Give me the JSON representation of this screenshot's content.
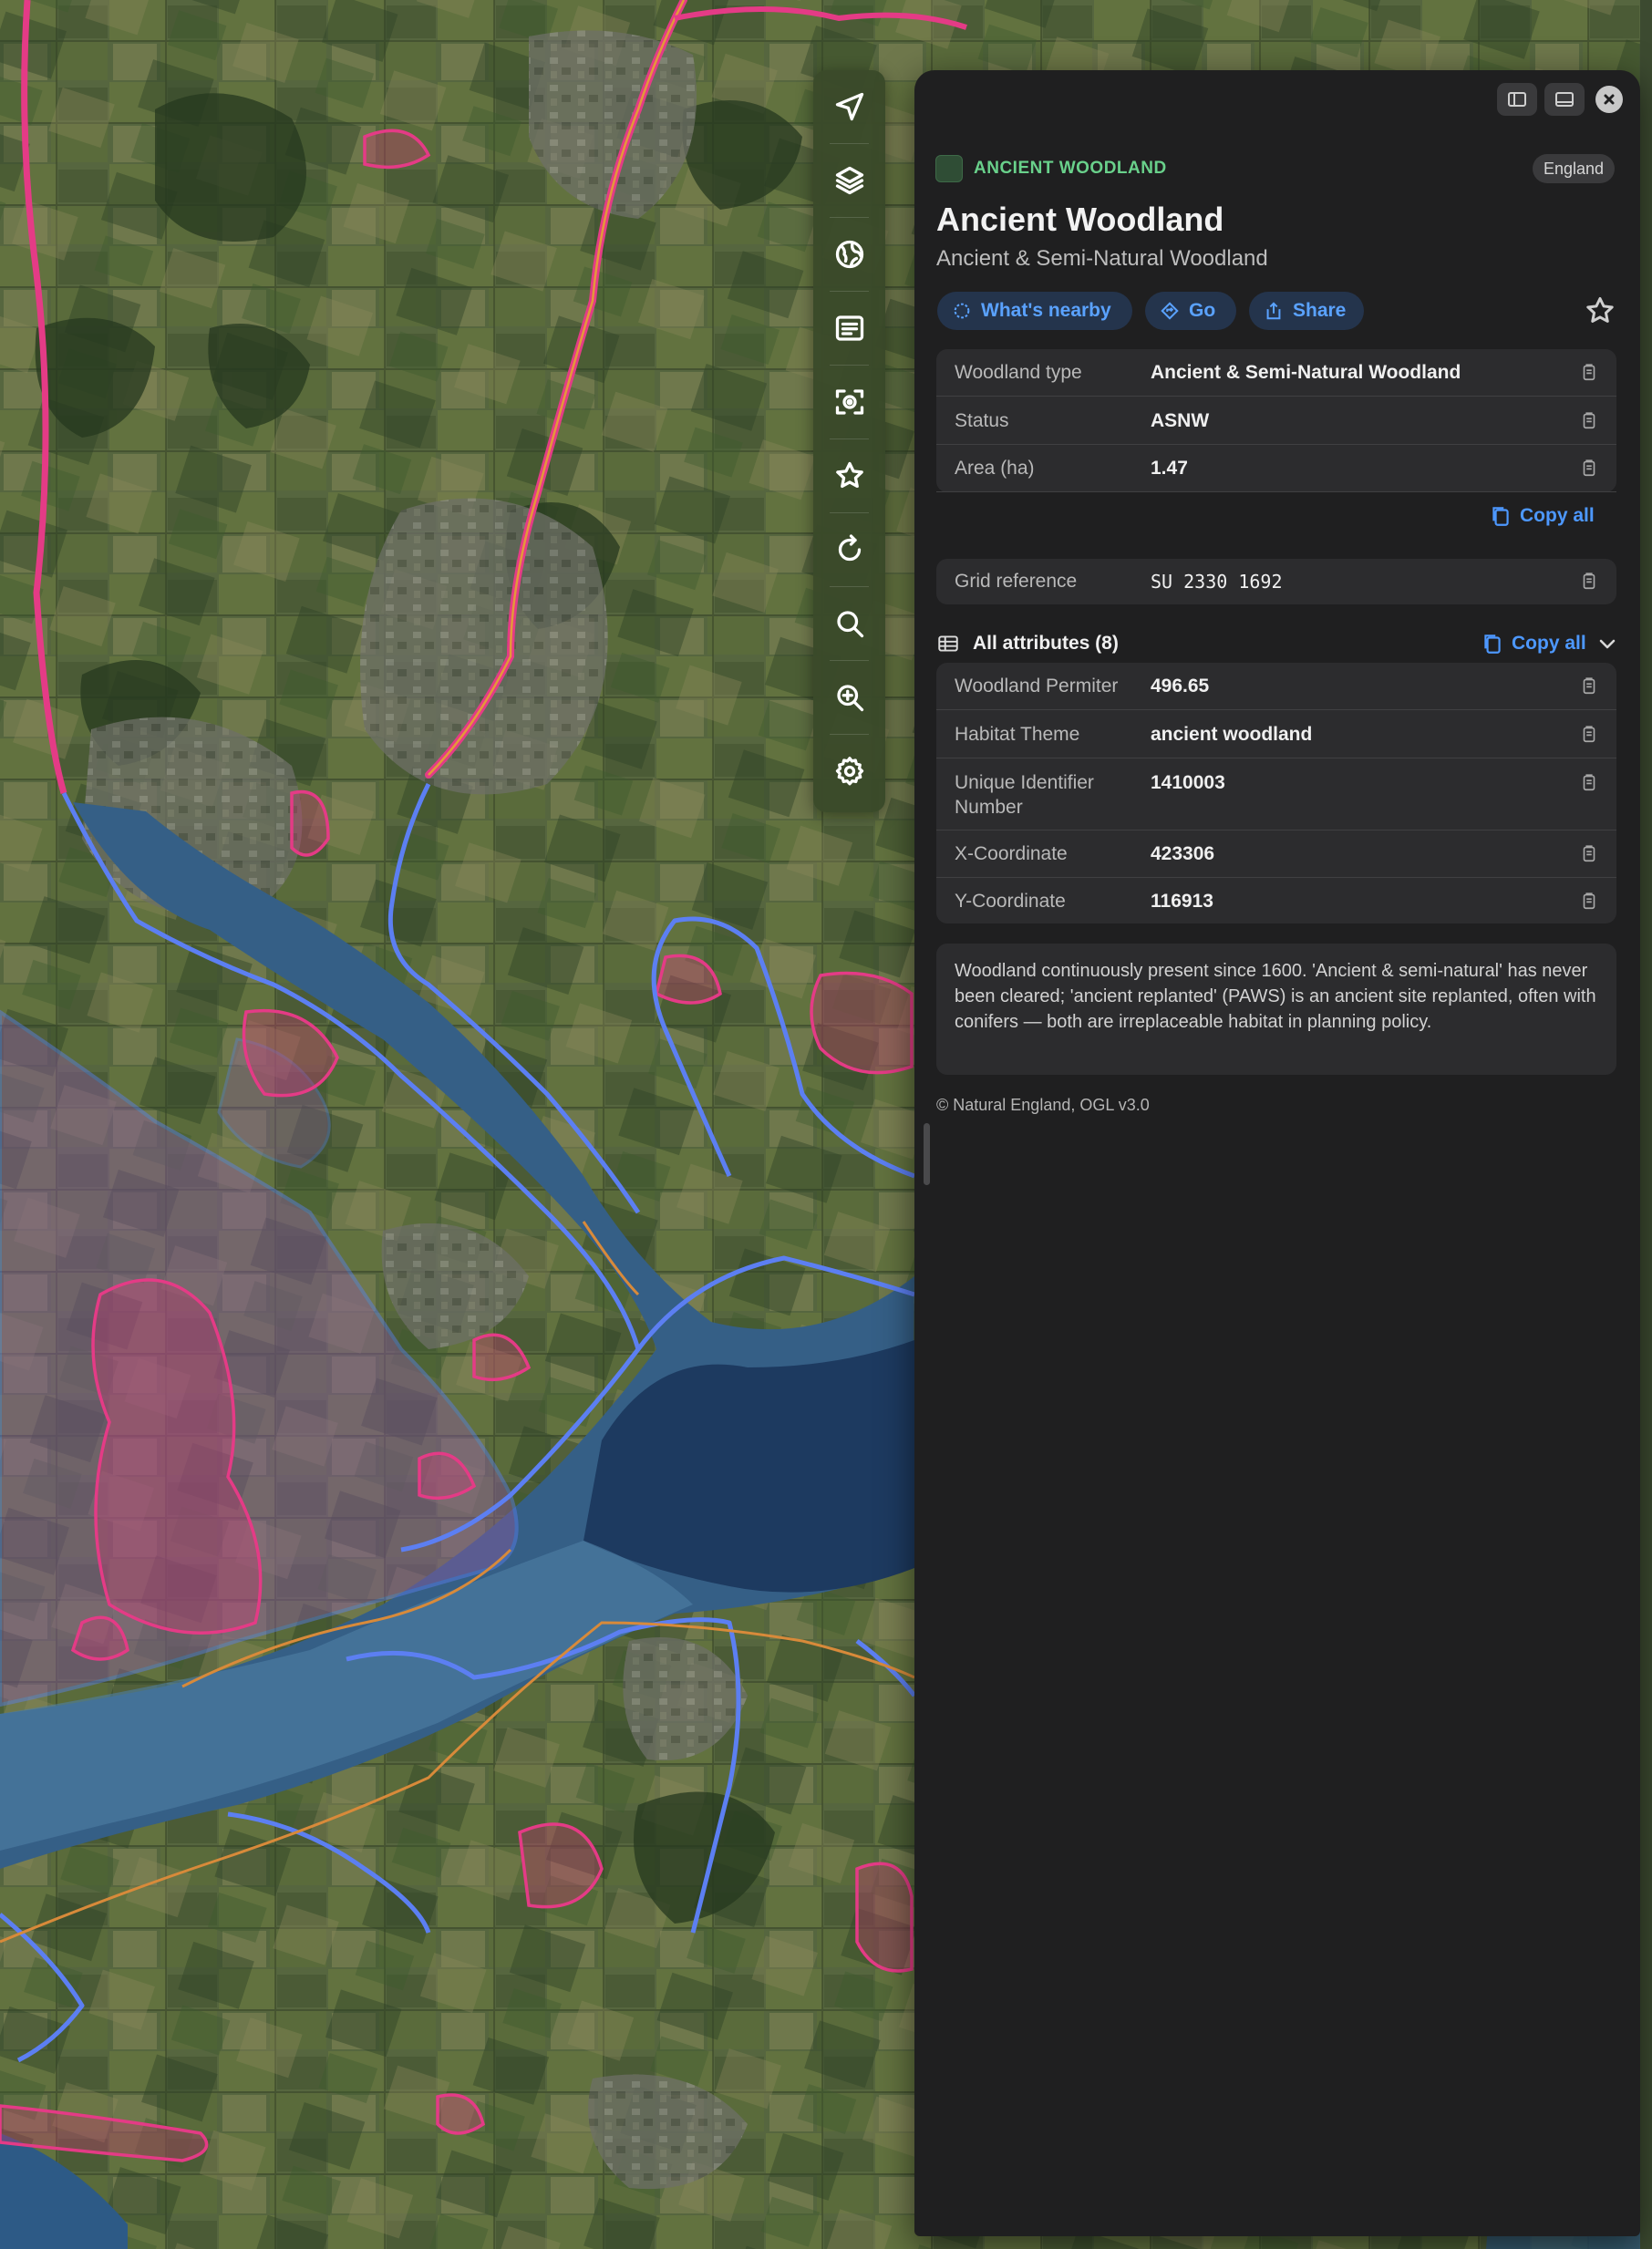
{
  "toolbar": {
    "items": [
      "navigate-icon",
      "layers-icon",
      "globe-icon",
      "list-icon",
      "locate-icon",
      "star-icon",
      "refresh-icon",
      "search-icon",
      "zoom-in-icon",
      "gear-icon"
    ]
  },
  "window": {
    "controls": [
      "sidebar-toggle-icon",
      "bottom-panel-icon",
      "close-icon"
    ]
  },
  "feature": {
    "category": "ANCIENT WOODLAND",
    "region": "England",
    "title": "Ancient Woodland",
    "subtitle": "Ancient & Semi-Natural Woodland",
    "swatch_color": "#2f4d35",
    "category_color": "#69d18b"
  },
  "actions": {
    "nearby": "What's nearby",
    "go": "Go",
    "share": "Share"
  },
  "summary": {
    "rows": [
      {
        "label": "Woodland type",
        "value": "Ancient & Semi-Natural Woodland"
      },
      {
        "label": "Status",
        "value": "ASNW"
      },
      {
        "label": "Area (ha)",
        "value": "1.47"
      }
    ],
    "copy_all": "Copy all"
  },
  "grid": {
    "label": "Grid reference",
    "value": "SU 2330 1692"
  },
  "attributes": {
    "heading": "All attributes (8)",
    "copy_all": "Copy all",
    "rows": [
      {
        "label": "Woodland Permiter",
        "value": "496.65"
      },
      {
        "label": "Habitat Theme",
        "value": "ancient woodland"
      },
      {
        "label": "Unique Identifier",
        "label2": "Number",
        "value": "1410003"
      },
      {
        "label": "X-Coordinate",
        "value": "423306"
      },
      {
        "label": "Y-Coordinate",
        "value": "116913"
      }
    ]
  },
  "description": "Woodland continuously present since 1600. 'Ancient & semi-natural' has never been cleared; 'ancient replanted' (PAWS) is an ancient site replanted, often with conifers — both are irreplaceable habitat in planning policy.",
  "attribution": "© Natural England, OGL v3.0",
  "map_colors": {
    "land": "#4f5e3c",
    "water": "#2b5a8a",
    "deep_water": "#1b3a63",
    "woodland_outline": "#e43b86",
    "protected_outline": "#5c7ff2",
    "boundary_outline": "#d88a3a"
  }
}
